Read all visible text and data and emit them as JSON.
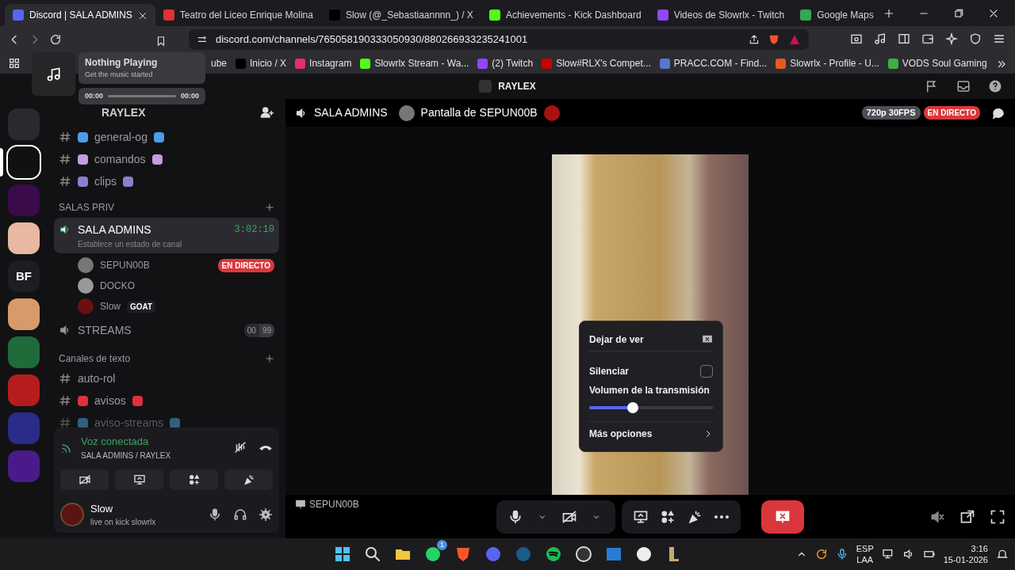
{
  "browser": {
    "tabs": [
      {
        "title": "Discord | SALA ADMINS",
        "selected": true
      },
      {
        "title": "Teatro del Liceo Enrique Molina",
        "selected": false
      },
      {
        "title": "Slow (@_Sebastiaannnn_) / X",
        "selected": false
      },
      {
        "title": "Achievements - Kick Dashboard",
        "selected": false
      },
      {
        "title": "Videos de Slowrlx - Twitch",
        "selected": false
      },
      {
        "title": "Google Maps",
        "selected": false
      }
    ],
    "address": "discord.com/channels/765058190333050930/880266933235241001",
    "bookmarks": [
      "ube",
      "Inicio / X",
      "Instagram",
      "Slowrlx Stream - Wa...",
      "(2) Twitch",
      "Slow#RLX's Compet...",
      "PRACC.COM - Find...",
      "Slowrlx - Profile - U...",
      "VODS Soul Gaming"
    ],
    "media_popup": {
      "title": "Nothing Playing",
      "subtitle": "Get the music started",
      "elapsed": "00:00",
      "total": "00:00"
    }
  },
  "discord": {
    "title": "RAYLEX",
    "servers": [
      {
        "selected": false
      },
      {
        "selected": true
      },
      {
        "selected": false
      },
      {
        "selected": false
      },
      {
        "label": "BF",
        "selected": false
      },
      {
        "selected": false
      },
      {
        "selected": false
      },
      {
        "selected": false
      },
      {
        "selected": false
      },
      {
        "selected": false
      }
    ],
    "server_name": "RAYLEX",
    "channels": [
      {
        "kind": "text",
        "name": "general-og",
        "selected": false
      },
      {
        "kind": "text",
        "name": "comandos",
        "selected": false
      },
      {
        "kind": "text",
        "name": "clips",
        "selected": false
      },
      {
        "kind": "category",
        "name": "SALAS PRIV"
      },
      {
        "kind": "voice",
        "name": "SALA ADMINS",
        "selected": true,
        "timer": "3:02:10",
        "status": "Establece un estado de canal",
        "members": [
          {
            "name": "SEPUN00B",
            "badge": "EN DIRECTO"
          },
          {
            "name": "DOCKO"
          },
          {
            "name": "Slow",
            "tag": "GOAT"
          }
        ]
      },
      {
        "kind": "voice",
        "name": "STREAMS",
        "selected": false,
        "count": "00",
        "limit": "99"
      },
      {
        "kind": "category",
        "name": "Canales de texto"
      },
      {
        "kind": "text",
        "name": "auto-rol",
        "selected": false
      },
      {
        "kind": "text",
        "name": "avisos",
        "selected": false
      },
      {
        "kind": "text",
        "name": "aviso-streams",
        "selected": false
      }
    ],
    "voice_panel": {
      "status": "Voz conectada",
      "location": "SALA ADMINS / RAYLEX"
    },
    "user": {
      "name": "Slow",
      "status": "live on kick slowrlx"
    },
    "stream": {
      "channel": "SALA ADMINS",
      "title": "Pantalla de SEPUN00B",
      "quality": "720p 30FPS",
      "live": "EN DIRECTO",
      "streamer": "SEPUN00B",
      "menu": {
        "stop": "Dejar de ver",
        "mute_label": "Silenciar",
        "muted": false,
        "volume_label": "Volumen de la transmisión",
        "level": 0.35,
        "more": "Más opciones"
      }
    }
  },
  "taskbar": {
    "whatsapp_badge": "1",
    "lang": "ESP",
    "layout": "LAA",
    "time": "3:16",
    "date": "15-01-2026"
  }
}
